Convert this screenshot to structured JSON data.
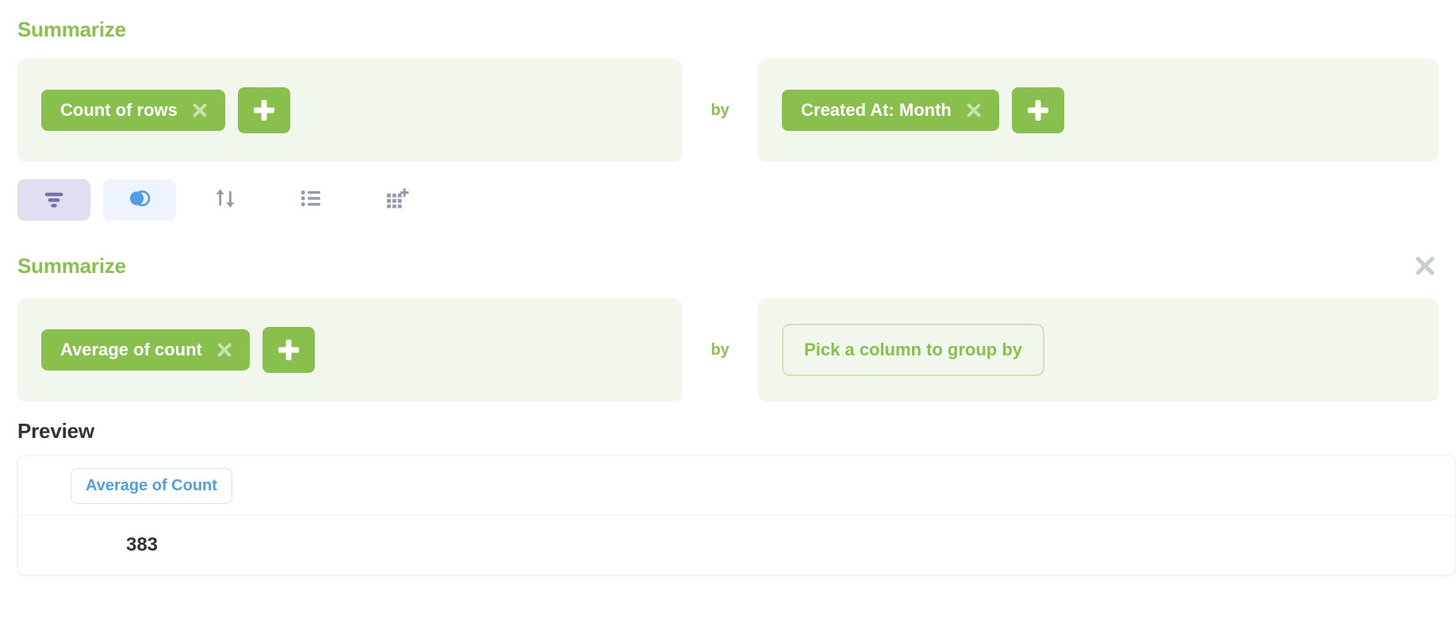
{
  "steps": [
    {
      "heading": "Summarize",
      "removable": false,
      "metrics": [
        {
          "label": "Count of rows",
          "remove_icon": "close-icon"
        }
      ],
      "add_metric_icon": "plus-icon",
      "by_label": "by",
      "breakouts": [
        {
          "label": "Created At: Month",
          "remove_icon": "close-icon"
        }
      ],
      "add_breakout_icon": "plus-icon",
      "breakout_placeholder": null
    },
    {
      "heading": "Summarize",
      "removable": true,
      "remove_step_icon": "close-icon",
      "metrics": [
        {
          "label": "Average of count",
          "remove_icon": "close-icon"
        }
      ],
      "add_metric_icon": "plus-icon",
      "by_label": "by",
      "breakouts": [],
      "breakout_placeholder": "Pick a column to group by"
    }
  ],
  "action_bar": {
    "buttons": [
      {
        "name": "filter",
        "icon": "filter-icon",
        "active": true,
        "tint": "#7172ad",
        "bg": "#dfdef2"
      },
      {
        "name": "join",
        "icon": "join-icon",
        "active": true,
        "tint": "#509ee3",
        "bg": "#eef4fd"
      },
      {
        "name": "sort",
        "icon": "sort-icon",
        "active": false,
        "tint": "#949aab",
        "bg": "transparent"
      },
      {
        "name": "summarize",
        "icon": "list-icon",
        "active": false,
        "tint": "#949aab",
        "bg": "transparent"
      },
      {
        "name": "pivot",
        "icon": "grid-plus-icon",
        "active": false,
        "tint": "#949aab",
        "bg": "transparent"
      }
    ]
  },
  "preview": {
    "heading": "Preview",
    "columns": [
      "Average of Count"
    ],
    "rows": [
      [
        "383"
      ]
    ]
  },
  "colors": {
    "brand_green": "#88bf4d",
    "panel_green": "#f2f7ed",
    "placeholder_border": "#cfe3b8",
    "blue": "#509ee3",
    "purple": "#7172ad",
    "text_dark": "#2e353b",
    "muted_gray": "#c7cdd1"
  }
}
